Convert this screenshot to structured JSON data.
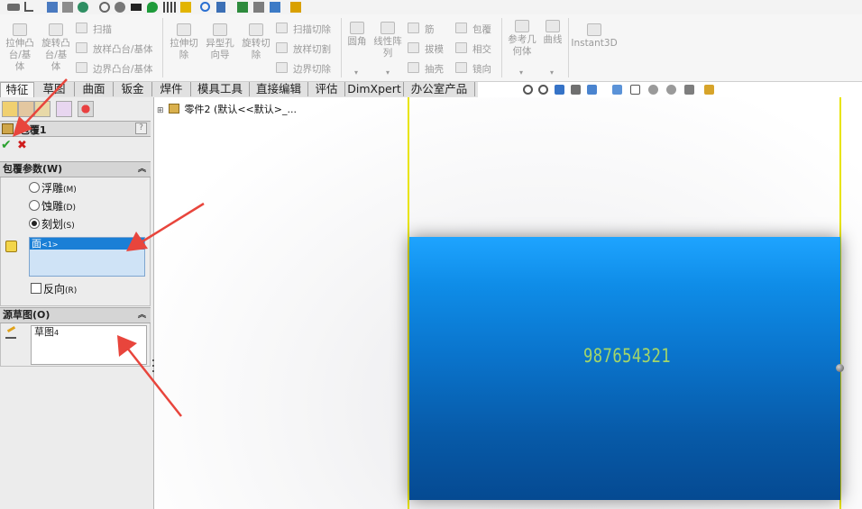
{
  "ribbon": {
    "extrude_boss": [
      "拉伸凸",
      "台/基",
      "体"
    ],
    "revolve_boss": [
      "旋转凸",
      "台/基",
      "体"
    ],
    "sweep": "扫描",
    "loft_boss": "放样凸台/基体",
    "boundary_boss": "边界凸台/基体",
    "extrude_cut": [
      "拉伸切",
      "除"
    ],
    "hole_wizard": [
      "异型孔",
      "向导"
    ],
    "revolve_cut": [
      "旋转切",
      "除"
    ],
    "swept_cut": "扫描切除",
    "lofted_cut": "放样切割",
    "boundary_cut": "边界切除",
    "fillet": "圆角",
    "linear_pattern": [
      "线性阵",
      "列"
    ],
    "rib": "筋",
    "draft": "拔模",
    "shell": "抽壳",
    "wrap": "包覆",
    "intersect": "相交",
    "mirror": "镜向",
    "ref_geometry": [
      "参考几",
      "何体"
    ],
    "curves": "曲线",
    "instant3d": "Instant3D"
  },
  "tabs": [
    "特征",
    "草图",
    "曲面",
    "钣金",
    "焊件",
    "模具工具",
    "直接编辑",
    "评估",
    "DimXpert",
    "办公室产品"
  ],
  "panel": {
    "title": "包覆1",
    "help": "?",
    "ok_glyph": "✔",
    "cancel_glyph": "✖",
    "wrap_params_title": "包覆参数(W)",
    "emboss": "浮雕",
    "emboss_key": "(M)",
    "deboss": "蚀雕",
    "deboss_key": "(D)",
    "scribe": "刻划",
    "scribe_key": "(S)",
    "face_item": "面",
    "face_item_sub": "<1>",
    "reverse": "反向",
    "reverse_key": "(R)",
    "source_sketch_title": "源草图(O)",
    "sketch_item": "草图",
    "sketch_item_num": "4"
  },
  "tree": {
    "expand": "⊞",
    "part_label": "零件2  (默认<<默认>_..."
  },
  "model": {
    "engraved_text": "987654321"
  },
  "colors": {
    "arrow": "#e8453c",
    "part_top": "#1ea4ff",
    "part_bottom": "#054a92",
    "selection": "#1a7fd6",
    "yellow_line": "#e8e400"
  }
}
